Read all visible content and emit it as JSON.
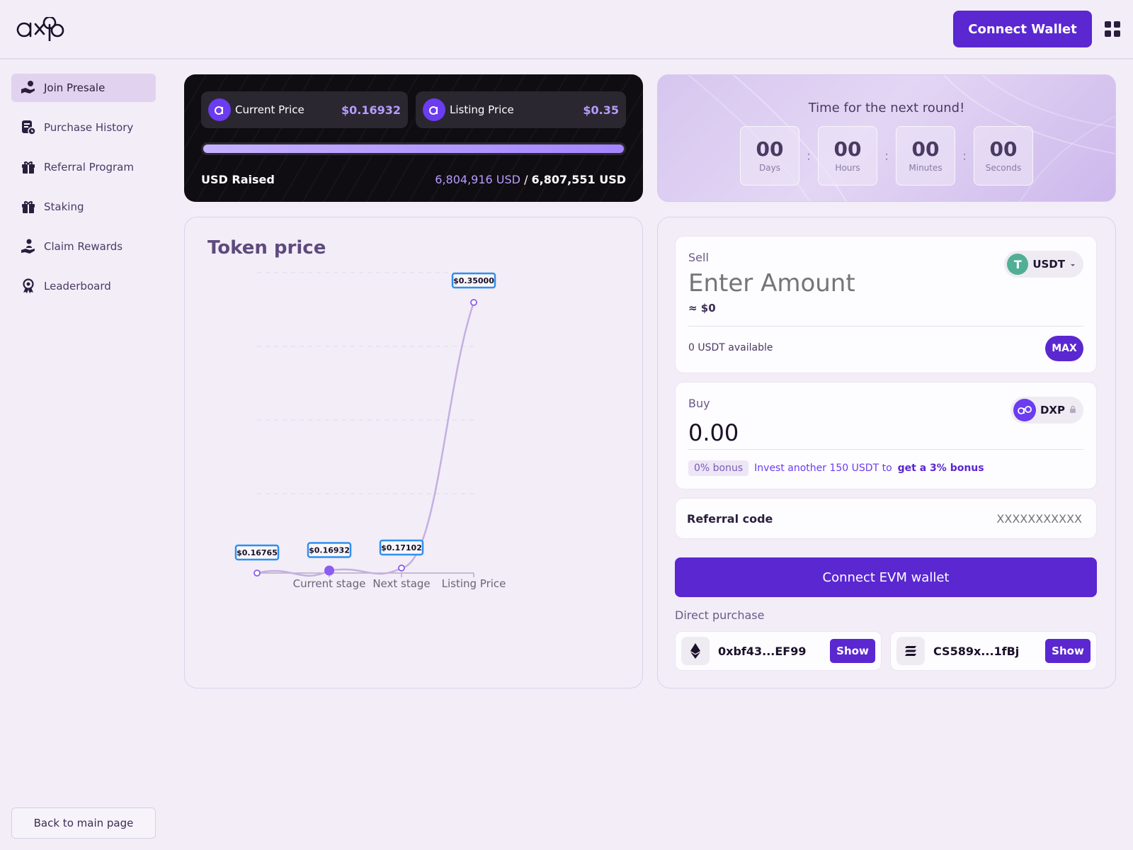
{
  "header": {
    "logo_text": "dxp",
    "connect_wallet_label": "Connect Wallet"
  },
  "sidebar": {
    "items": [
      {
        "label": "Join Presale",
        "icon": "hand-coin-icon",
        "active": true
      },
      {
        "label": "Purchase History",
        "icon": "receipt-clock-icon"
      },
      {
        "label": "Referral Program",
        "icon": "gift-icon"
      },
      {
        "label": "Staking",
        "icon": "gift-icon"
      },
      {
        "label": "Claim Rewards",
        "icon": "hand-user-icon"
      },
      {
        "label": "Leaderboard",
        "icon": "award-badge-icon"
      }
    ],
    "back_label": "Back to main page"
  },
  "price_card": {
    "current_price_label": "Current Price",
    "current_price_value": "$0.16932",
    "listing_price_label": "Listing Price",
    "listing_price_value": "$0.35",
    "progress_fraction": 0.9996,
    "raised_label": "USD Raised",
    "raised_current": "6,804,916 USD",
    "raised_separator": "/",
    "raised_goal": "6,807,551 USD"
  },
  "countdown": {
    "title": "Time for the next round!",
    "units": [
      {
        "value": "00",
        "label": "Days"
      },
      {
        "value": "00",
        "label": "Hours"
      },
      {
        "value": "00",
        "label": "Minutes"
      },
      {
        "value": "00",
        "label": "Seconds"
      }
    ],
    "separator": ":"
  },
  "chart": {
    "title": "Token price"
  },
  "chart_data": {
    "type": "line",
    "title": "Token price",
    "categories": [
      "",
      "Current stage",
      "Next stage",
      "Listing Price"
    ],
    "values": [
      0.16765,
      0.16932,
      0.17102,
      0.35
    ],
    "point_labels": [
      "$0.16765",
      "$0.16932",
      "$0.17102",
      "$0.35000"
    ],
    "highlight_index": 1,
    "ylim": [
      0.16765,
      0.35
    ],
    "grid": true,
    "series_color": "#c4b0e0",
    "point_color": "#8a5cf0"
  },
  "swap": {
    "sell_label": "Sell",
    "sell_placeholder": "Enter Amount",
    "sell_usd": "≈ $0",
    "sell_token": "USDT",
    "sell_token_icon": "T",
    "available": "0 USDT available",
    "max_label": "MAX",
    "buy_label": "Buy",
    "buy_amount": "0.00",
    "buy_token": "DXP",
    "bonus_chip": "0% bonus",
    "bonus_text": "Invest another 150 USDT to",
    "bonus_link": "get a 3% bonus",
    "referral_label": "Referral code",
    "referral_placeholder": "XXXXXXXXXXX",
    "evm_button": "Connect EVM wallet",
    "direct_label": "Direct purchase",
    "addresses": [
      {
        "text": "0xbf43...EF99",
        "icon": "ethereum-icon",
        "button": "Show"
      },
      {
        "text": "CS589x...1fBj",
        "icon": "solana-icon",
        "button": "Show"
      }
    ]
  },
  "colors": {
    "accent": "#5a27d1",
    "background": "#f3edf8",
    "dark_card": "#0f0d12",
    "price_text": "#b79cff"
  }
}
